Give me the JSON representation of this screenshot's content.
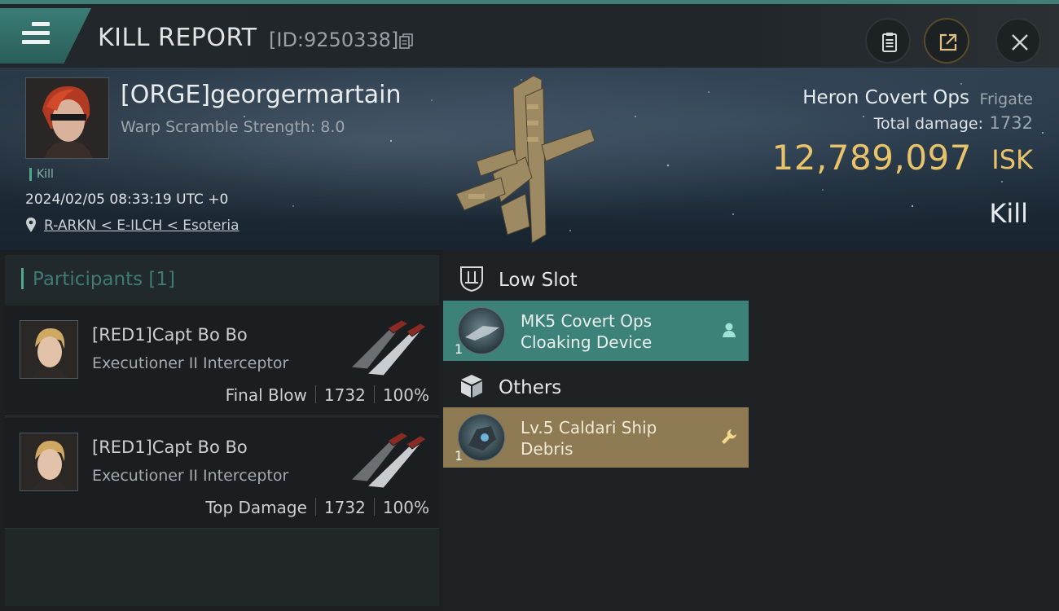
{
  "header": {
    "title": "KILL REPORT",
    "id_text": "[ID:9250338]",
    "buttons": [
      "notes-icon",
      "share-icon",
      "close-icon"
    ]
  },
  "victim": {
    "name": "[ORGE]georgermartain",
    "scramble": "Warp Scramble Strength: 8.0",
    "tag": "Kill",
    "time": "2024/02/05 08:33:19 UTC +0",
    "location": "R-ARKN < E-ILCH < Esoteria"
  },
  "ship": {
    "name": "Heron Covert Ops",
    "class": "Frigate",
    "damage_label": "Total damage:",
    "damage_value": "1732",
    "isk_value": "12,789,097",
    "isk_unit": "ISK",
    "kill_type": "Kill"
  },
  "participants": {
    "title": "Participants [1]",
    "rows": [
      {
        "name": "[RED1]Capt Bo Bo",
        "ship": "Executioner II Interceptor",
        "role": "Final Blow",
        "damage": "1732",
        "percent": "100%"
      },
      {
        "name": "[RED1]Capt Bo Bo",
        "ship": "Executioner II Interceptor",
        "role": "Top Damage",
        "damage": "1732",
        "percent": "100%"
      }
    ]
  },
  "slots": {
    "low": {
      "label": "Low Slot",
      "item": {
        "name": "MK5 Covert Ops Cloaking Device",
        "qty": "1"
      }
    },
    "others": {
      "label": "Others",
      "item": {
        "name": "Lv.5 Caldari Ship Debris",
        "qty": "1"
      }
    }
  },
  "colors": {
    "accent_teal": "#3d8278",
    "isk_gold": "#e9c36a",
    "debris_tan": "#8f7b53"
  }
}
